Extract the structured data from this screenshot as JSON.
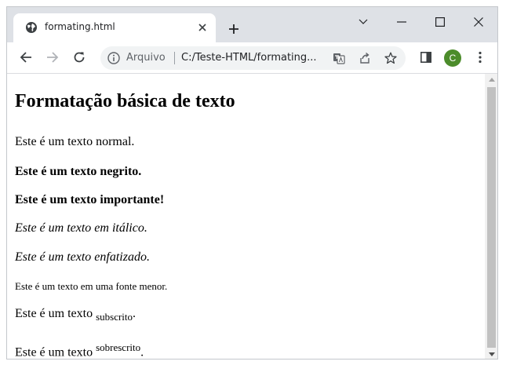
{
  "tab": {
    "title": "formating.html",
    "favicon": "globe-icon"
  },
  "window_controls": [
    "chevron-down-icon",
    "minimize-icon",
    "maximize-icon",
    "close-icon"
  ],
  "toolbar": {
    "origin_label": "Arquivo",
    "url": "C:/Teste-HTML/formating...",
    "avatar_letter": "C",
    "avatar_color": "#4c8c2b"
  },
  "page": {
    "heading": "Formatação básica de texto",
    "normal": "Este é um texto normal.",
    "bold": "Este é um texto negrito.",
    "strong": "Este é um texto importante!",
    "italic": "Este é um texto em itálico.",
    "emphasis": "Este é um texto enfatizado.",
    "small": "Este é um texto em uma fonte menor.",
    "sub_prefix": "Este é um texto ",
    "sub_text": "subscrito",
    "sub_suffix": ".",
    "sup_prefix": "Este é um texto ",
    "sup_text": "sobrescrito",
    "sup_suffix": "."
  }
}
